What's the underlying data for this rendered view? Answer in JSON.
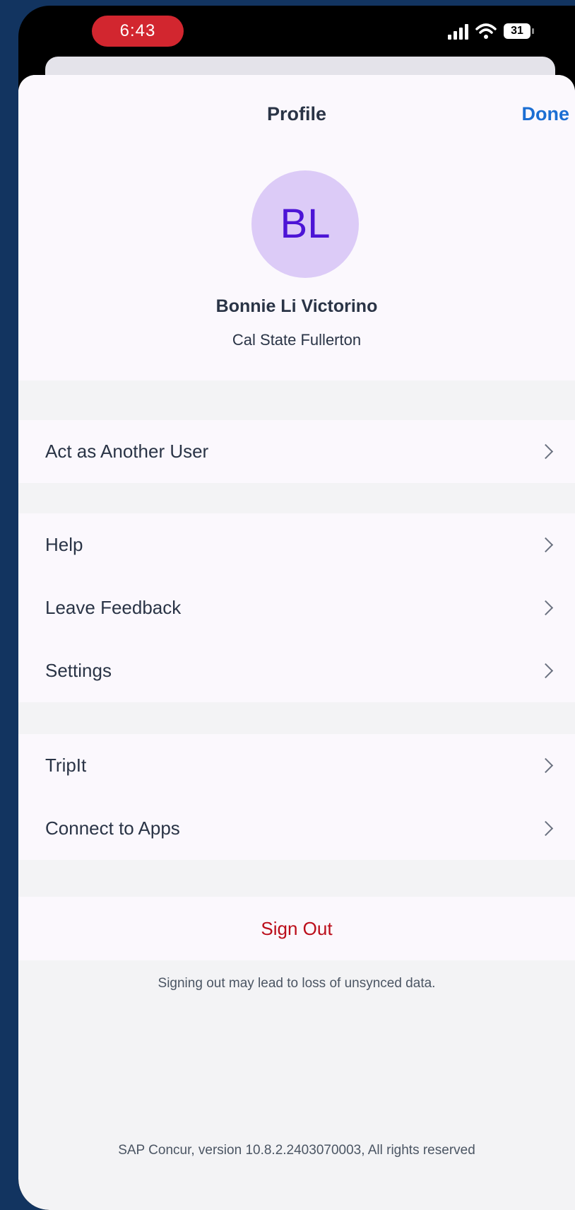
{
  "status_bar": {
    "time": "6:43",
    "battery": "31"
  },
  "header": {
    "title": "Profile",
    "done_label": "Done"
  },
  "profile": {
    "initials": "BL",
    "name": "Bonnie Li Victorino",
    "organization": "Cal State Fullerton"
  },
  "groups": [
    {
      "items": [
        {
          "label": "Act as Another User"
        }
      ]
    },
    {
      "items": [
        {
          "label": "Help"
        },
        {
          "label": "Leave Feedback"
        },
        {
          "label": "Settings"
        }
      ]
    },
    {
      "items": [
        {
          "label": "TripIt"
        },
        {
          "label": "Connect to Apps"
        }
      ]
    }
  ],
  "sign_out": {
    "label": "Sign Out",
    "note": "Signing out may lead to loss of unsynced data."
  },
  "footer": {
    "version": "SAP Concur, version 10.8.2.2403070003, All rights reserved"
  },
  "colors": {
    "accent": "#1b6ed3",
    "danger": "#bb0d1a",
    "avatar_bg": "#dccbf7",
    "avatar_text": "#4c14d6"
  }
}
